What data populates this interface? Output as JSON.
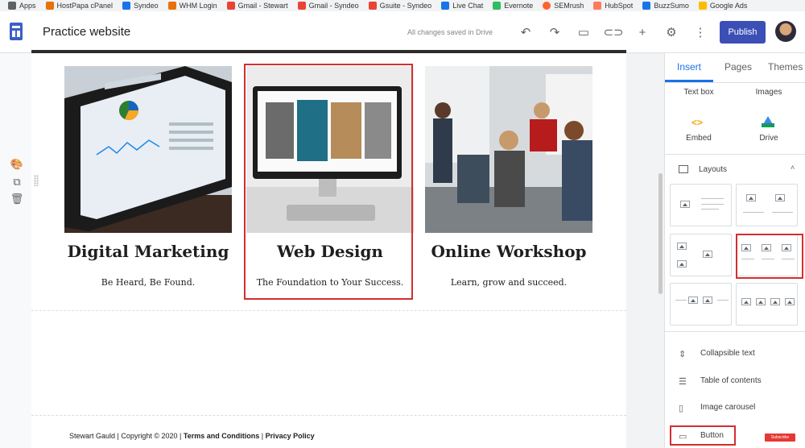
{
  "bookmarks": [
    {
      "label": "Apps",
      "color": "#5f6368"
    },
    {
      "label": "HostPapa cPanel",
      "color": "#e8710a"
    },
    {
      "label": "Syndeo",
      "color": "#1a73e8"
    },
    {
      "label": "WHM Login",
      "color": "#e8710a"
    },
    {
      "label": "Gmail - Stewart",
      "color": "#ea4335"
    },
    {
      "label": "Gmail - Syndeo",
      "color": "#ea4335"
    },
    {
      "label": "Gsuite - Syndeo",
      "color": "#ea4335"
    },
    {
      "label": "Live Chat",
      "color": "#1a73e8"
    },
    {
      "label": "Evernote",
      "color": "#2dbe60"
    },
    {
      "label": "SEMrush",
      "color": "#ff642d"
    },
    {
      "label": "HubSpot",
      "color": "#ff7a59"
    },
    {
      "label": "BuzzSumo",
      "color": "#1a73e8"
    },
    {
      "label": "Google Ads",
      "color": "#fbbc04"
    }
  ],
  "header": {
    "site_title": "Practice website",
    "save_status": "All changes saved in Drive",
    "publish_label": "Publish",
    "icons": [
      "undo-icon",
      "redo-icon",
      "preview-icon",
      "link-icon",
      "share-icon",
      "settings-icon",
      "more-icon"
    ]
  },
  "toolstrip": {
    "icons": [
      "palette-icon",
      "duplicate-icon",
      "delete-icon"
    ]
  },
  "cards": [
    {
      "title": "Digital Marketing",
      "subtitle": "Be Heard, Be Found.",
      "image": "tablet-analytics-photo"
    },
    {
      "title": "Web Design",
      "subtitle": "The Foundation to Your Success.",
      "image": "monitor-gallery-photo"
    },
    {
      "title": "Online Workshop",
      "subtitle": "Learn, grow and succeed.",
      "image": "office-meeting-photo"
    }
  ],
  "footer": {
    "prefix": "Stewart Gauld | Copyright © 2020 | ",
    "terms": "Terms and Conditions",
    "sep": " | ",
    "privacy": "Privacy Policy"
  },
  "panel": {
    "tabs": [
      "Insert",
      "Pages",
      "Themes"
    ],
    "active_tab": "Insert",
    "insert_items": [
      {
        "label": "Text box"
      },
      {
        "label": "Images"
      },
      {
        "label": "Embed",
        "icon": "embed-icon"
      },
      {
        "label": "Drive",
        "icon": "drive-icon"
      }
    ],
    "layouts_label": "Layouts",
    "components": [
      {
        "label": "Collapsible text",
        "icon": "collapsible-text-icon"
      },
      {
        "label": "Table of contents",
        "icon": "table-of-contents-icon"
      },
      {
        "label": "Image carousel",
        "icon": "image-carousel-icon"
      },
      {
        "label": "Button",
        "icon": "button-icon"
      }
    ]
  },
  "badge": {
    "label": "Subscribe"
  },
  "colors": {
    "accent": "#1a73e8",
    "publish": "#3c4fb6",
    "highlight": "#d32f2f"
  }
}
